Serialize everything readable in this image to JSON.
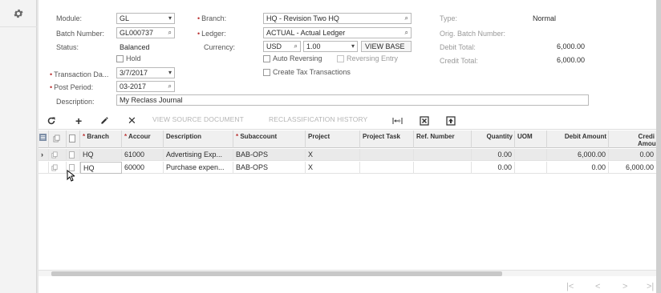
{
  "form": {
    "module_label": "Module:",
    "module_value": "GL",
    "batch_label": "Batch Number:",
    "batch_value": "GL000737",
    "status_label": "Status:",
    "status_value": "Balanced",
    "hold_label": "Hold",
    "txn_date_label": "Transaction Da...",
    "txn_date_value": "3/7/2017",
    "post_period_label": "Post Period:",
    "post_period_value": "03-2017",
    "description_label": "Description:",
    "description_value": "My Reclass Journal",
    "branch_label": "Branch:",
    "branch_value": "HQ - Revision Two HQ",
    "ledger_label": "Ledger:",
    "ledger_value": "ACTUAL - Actual Ledger",
    "currency_label": "Currency:",
    "currency_value": "USD",
    "rate_value": "1.00",
    "view_base_label": "VIEW BASE",
    "auto_reversing_label": "Auto Reversing",
    "reversing_entry_label": "Reversing Entry",
    "create_tax_label": "Create Tax Transactions",
    "type_label": "Type:",
    "type_value": "Normal",
    "orig_batch_label": "Orig. Batch Number:",
    "orig_batch_value": "",
    "debit_total_label": "Debit Total:",
    "debit_total_value": "6,000.00",
    "credit_total_label": "Credit Total:",
    "credit_total_value": "6,000.00"
  },
  "toolbar": {
    "view_source_label": "VIEW SOURCE DOCUMENT",
    "reclass_history_label": "RECLASSIFICATION HISTORY"
  },
  "grid": {
    "columns": {
      "branch": "Branch",
      "account": "Accour",
      "description": "Description",
      "subaccount": "Subaccount",
      "project": "Project",
      "project_task": "Project Task",
      "ref_number": "Ref. Number",
      "quantity": "Quantity",
      "uom": "UOM",
      "debit": "Debit Amount",
      "credit": "Credi Amoun"
    },
    "rows": [
      {
        "branch": "HQ",
        "account": "61000",
        "description": "Advertising Exp...",
        "subaccount": "BAB-OPS",
        "project": "X",
        "project_task": "",
        "ref_number": "",
        "quantity": "0.00",
        "uom": "",
        "debit": "6,000.00",
        "credit": "0.00"
      },
      {
        "branch": "HQ",
        "account": "60000",
        "description": "Purchase expen...",
        "subaccount": "BAB-OPS",
        "project": "X",
        "project_task": "",
        "ref_number": "",
        "quantity": "0.00",
        "uom": "",
        "debit": "0.00",
        "credit": "6,000.00"
      }
    ]
  },
  "icons": {
    "settings": "gear-icon",
    "refresh": "refresh-icon",
    "add": "plus-icon",
    "edit": "pencil-icon",
    "delete": "close-icon",
    "fit_columns": "fit-columns-icon",
    "export": "export-excel-icon",
    "upload": "upload-icon",
    "search": "search-icon",
    "dropdown": "chevron-down-icon"
  },
  "colors": {
    "background": "#e6e6e6",
    "required_marker": "#b33333",
    "selected_row": "#eaeaea"
  }
}
